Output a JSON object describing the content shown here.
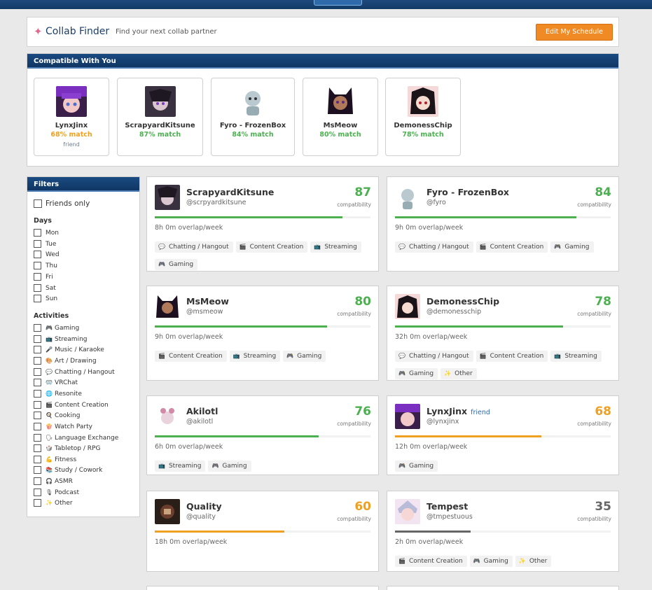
{
  "header": {
    "title": "Collab Finder",
    "subtitle": "Find your next collab partner",
    "edit_button": "Edit My Schedule"
  },
  "compatible": {
    "title": "Compatible With You",
    "people": [
      {
        "name": "LynxJinx",
        "match": "68% match",
        "note": "friend",
        "color": "#f0a020"
      },
      {
        "name": "ScrapyardKitsune",
        "match": "87% match",
        "note": "",
        "color": "#4caf50"
      },
      {
        "name": "Fyro - FrozenBox",
        "match": "84% match",
        "note": "",
        "color": "#4caf50"
      },
      {
        "name": "MsMeow",
        "match": "80% match",
        "note": "",
        "color": "#4caf50"
      },
      {
        "name": "DemonessChip",
        "match": "78% match",
        "note": "",
        "color": "#4caf50"
      }
    ]
  },
  "filters": {
    "title": "Filters",
    "friends_only": "Friends only",
    "days_title": "Days",
    "days": [
      "Mon",
      "Tue",
      "Wed",
      "Thu",
      "Fri",
      "Sat",
      "Sun"
    ],
    "activities_title": "Activities",
    "activities": [
      {
        "icon": "🎮",
        "label": "Gaming"
      },
      {
        "icon": "📺",
        "label": "Streaming"
      },
      {
        "icon": "🎤",
        "label": "Music / Karaoke"
      },
      {
        "icon": "🎨",
        "label": "Art / Drawing"
      },
      {
        "icon": "💬",
        "label": "Chatting / Hangout"
      },
      {
        "icon": "🥽",
        "label": "VRChat"
      },
      {
        "icon": "🌐",
        "label": "Resonite"
      },
      {
        "icon": "🎬",
        "label": "Content Creation"
      },
      {
        "icon": "🍳",
        "label": "Cooking"
      },
      {
        "icon": "🍿",
        "label": "Watch Party"
      },
      {
        "icon": "🗣",
        "label": "Language Exchange"
      },
      {
        "icon": "🎲",
        "label": "Tabletop / RPG"
      },
      {
        "icon": "💪",
        "label": "Fitness"
      },
      {
        "icon": "📚",
        "label": "Study / Cowork"
      },
      {
        "icon": "🎧",
        "label": "ASMR"
      },
      {
        "icon": "🎙",
        "label": "Podcast"
      },
      {
        "icon": "✨",
        "label": "Other"
      }
    ]
  },
  "score_label": "compatibility",
  "cards": [
    {
      "name": "ScrapyardKitsune",
      "handle": "@scrpyardkitsune",
      "friend": "",
      "score": "87",
      "overlap": "8h 0m overlap/week",
      "color": "#4caf50",
      "fill": 0.87,
      "tags": [
        [
          "💬",
          "Chatting / Hangout"
        ],
        [
          "🎬",
          "Content Creation"
        ],
        [
          "📺",
          "Streaming"
        ],
        [
          "🎮",
          "Gaming"
        ]
      ]
    },
    {
      "name": "Fyro - FrozenBox",
      "handle": "@fyro",
      "friend": "",
      "score": "84",
      "overlap": "9h 0m overlap/week",
      "color": "#4caf50",
      "fill": 0.84,
      "tags": [
        [
          "💬",
          "Chatting / Hangout"
        ],
        [
          "🎬",
          "Content Creation"
        ],
        [
          "🎮",
          "Gaming"
        ]
      ]
    },
    {
      "name": "MsMeow",
      "handle": "@msmeow",
      "friend": "",
      "score": "80",
      "overlap": "9h 0m overlap/week",
      "color": "#4caf50",
      "fill": 0.8,
      "tags": [
        [
          "🎬",
          "Content Creation"
        ],
        [
          "📺",
          "Streaming"
        ],
        [
          "🎮",
          "Gaming"
        ]
      ]
    },
    {
      "name": "DemonessChip",
      "handle": "@demonesschip",
      "friend": "",
      "score": "78",
      "overlap": "32h 0m overlap/week",
      "color": "#4caf50",
      "fill": 0.78,
      "tags": [
        [
          "💬",
          "Chatting / Hangout"
        ],
        [
          "🎬",
          "Content Creation"
        ],
        [
          "📺",
          "Streaming"
        ],
        [
          "🎮",
          "Gaming"
        ],
        [
          "✨",
          "Other"
        ]
      ]
    },
    {
      "name": "Akilotl",
      "handle": "@akilotl",
      "friend": "",
      "score": "76",
      "overlap": "6h 0m overlap/week",
      "color": "#4caf50",
      "fill": 0.76,
      "tags": [
        [
          "📺",
          "Streaming"
        ],
        [
          "🎮",
          "Gaming"
        ]
      ]
    },
    {
      "name": "LynxJinx",
      "handle": "@lynxjinx",
      "friend": "friend",
      "score": "68",
      "overlap": "12h 0m overlap/week",
      "color": "#f0a020",
      "fill": 0.68,
      "tags": [
        [
          "🎮",
          "Gaming"
        ]
      ]
    },
    {
      "name": "Quality",
      "handle": "@quality",
      "friend": "",
      "score": "60",
      "overlap": "18h 0m overlap/week",
      "color": "#f0a020",
      "fill": 0.6,
      "tags": []
    },
    {
      "name": "Tempest",
      "handle": "@tmpestuous",
      "friend": "",
      "score": "35",
      "overlap": "2h 0m overlap/week",
      "color": "#666666",
      "fill": 0.35,
      "tags": [
        [
          "🎬",
          "Content Creation"
        ],
        [
          "🎮",
          "Gaming"
        ],
        [
          "✨",
          "Other"
        ]
      ]
    }
  ]
}
